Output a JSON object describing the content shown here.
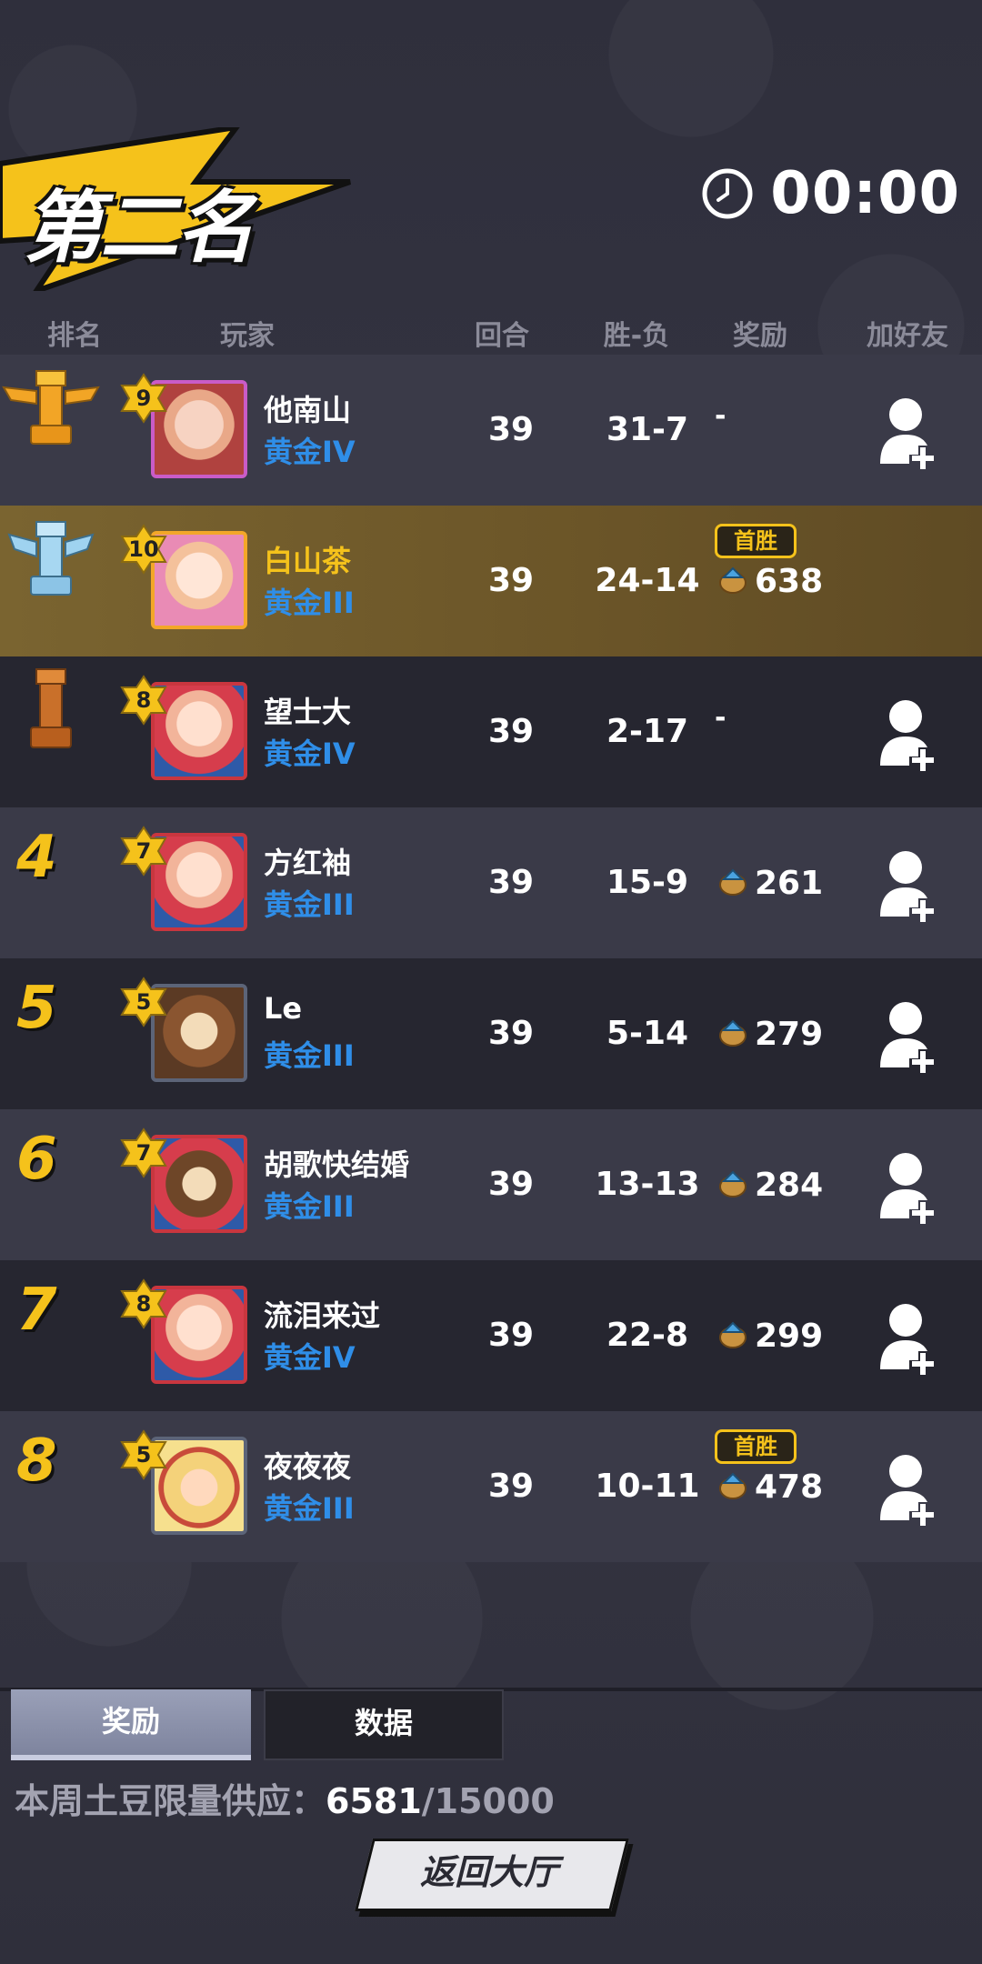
{
  "header": {
    "placement_title": "第二名",
    "timer": "00:00"
  },
  "columns": {
    "rank": "排名",
    "player": "玩家",
    "rounds": "回合",
    "win_loss": "胜-负",
    "reward": "奖励",
    "add_friend": "加好友"
  },
  "first_win_label": "首胜",
  "rows": [
    {
      "rank": "1",
      "trophy": "gold",
      "level": "9",
      "name": "他南山",
      "tier": "黄金IV",
      "rounds": "39",
      "wl": "31-7",
      "reward": "-",
      "first_win": false,
      "is_me": false,
      "add_friend": true
    },
    {
      "rank": "2",
      "trophy": "silver",
      "level": "10",
      "name": "白山茶",
      "tier": "黄金III",
      "rounds": "39",
      "wl": "24-14",
      "reward": "638",
      "first_win": true,
      "is_me": true,
      "add_friend": false
    },
    {
      "rank": "3",
      "trophy": "bronze",
      "level": "8",
      "name": "望士大",
      "tier": "黄金IV",
      "rounds": "39",
      "wl": "2-17",
      "reward": "-",
      "first_win": false,
      "is_me": false,
      "add_friend": true
    },
    {
      "rank": "4",
      "level": "7",
      "name": "方红袖",
      "tier": "黄金III",
      "rounds": "39",
      "wl": "15-9",
      "reward": "261",
      "first_win": false,
      "is_me": false,
      "add_friend": true
    },
    {
      "rank": "5",
      "level": "5",
      "name": "Le",
      "tier": "黄金III",
      "rounds": "39",
      "wl": "5-14",
      "reward": "279",
      "first_win": false,
      "is_me": false,
      "add_friend": true
    },
    {
      "rank": "6",
      "level": "7",
      "name": "胡歌快结婚",
      "tier": "黄金III",
      "rounds": "39",
      "wl": "13-13",
      "reward": "284",
      "first_win": false,
      "is_me": false,
      "add_friend": true
    },
    {
      "rank": "7",
      "level": "8",
      "name": "流泪来过",
      "tier": "黄金IV",
      "rounds": "39",
      "wl": "22-8",
      "reward": "299",
      "first_win": false,
      "is_me": false,
      "add_friend": true
    },
    {
      "rank": "8",
      "level": "5",
      "name": "夜夜夜",
      "tier": "黄金III",
      "rounds": "39",
      "wl": "10-11",
      "reward": "478",
      "first_win": true,
      "is_me": false,
      "add_friend": true
    }
  ],
  "tabs": {
    "rewards": "奖励",
    "stats": "数据"
  },
  "supply": {
    "label": "本周土豆限量供应：",
    "current": "6581",
    "total": "/15000"
  },
  "back_button": "返回大厅",
  "colors": {
    "gold_accent": "#f5c21b",
    "tier_blue": "#2f8ee8",
    "highlight_row": "#7a6430"
  }
}
